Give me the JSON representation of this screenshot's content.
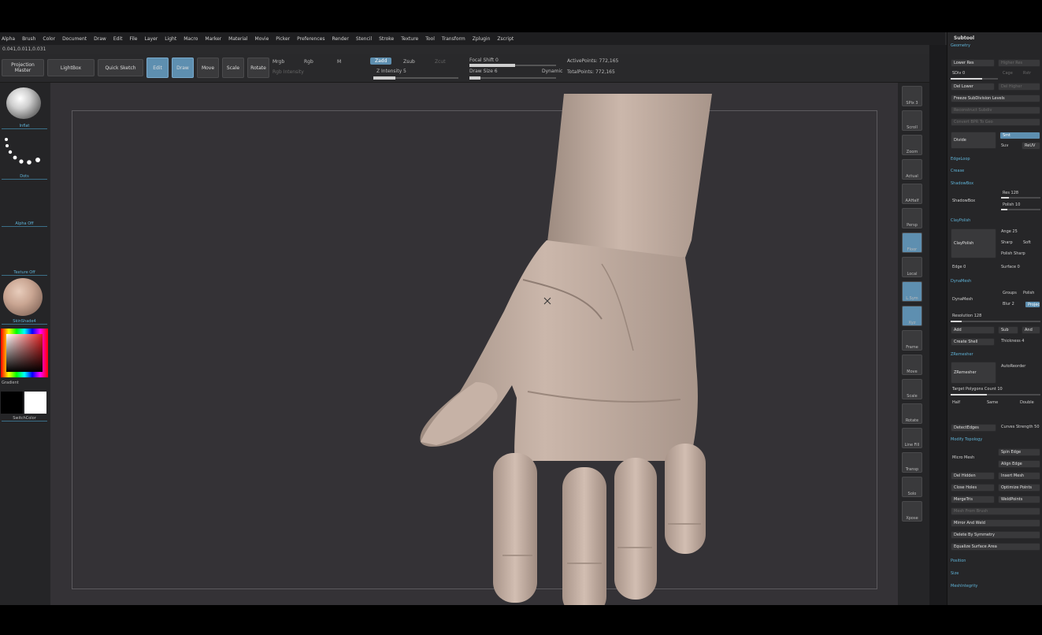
{
  "menu": [
    "Alpha",
    "Brush",
    "Color",
    "Document",
    "Draw",
    "Edit",
    "File",
    "Layer",
    "Light",
    "Macro",
    "Marker",
    "Material",
    "Movie",
    "Picker",
    "Preferences",
    "Render",
    "Stencil",
    "Stroke",
    "Texture",
    "Tool",
    "Transform",
    "Zplugin",
    "Zscript"
  ],
  "coords": "0.041,0.011,0.031",
  "toolbar": {
    "projection": "Projection Master",
    "lightbox": "LightBox",
    "quick_sketch": "Quick Sketch",
    "edit": "Edit",
    "draw": "Draw",
    "move": "Move",
    "scale": "Scale",
    "rotate": "Rotate",
    "mrgb": "Mrgb",
    "rgb": "Rgb",
    "m": "M",
    "rgb_intensity": "Rgb Intensity",
    "zadd": "Zadd",
    "zsub": "Zsub",
    "zcut": "Zcut",
    "z_intensity": "Z Intensity 5",
    "focal_shift": "Focal Shift 0",
    "draw_size": "Draw Size 6",
    "dynamic": "Dynamic",
    "active_points": "ActivePoints: 772,165",
    "total_points": "TotalPoints: 772,165"
  },
  "left_shelf": {
    "brush_label": "Inflat",
    "stroke_label": "Dots",
    "alpha_label": "Alpha Off",
    "texture_label": "Texture Off",
    "material_label": "SkinShade4",
    "gradient_label": "Gradient",
    "switch_label": "SwitchColor"
  },
  "right_shelf": [
    {
      "label": "SPix 3"
    },
    {
      "label": "Scroll"
    },
    {
      "label": "Zoom"
    },
    {
      "label": "Actual"
    },
    {
      "label": "AAHalf"
    },
    {
      "label": "Persp"
    },
    {
      "label": "Floor"
    },
    {
      "label": "Local"
    },
    {
      "label": "L.Sym"
    },
    {
      "label": "Xyz"
    },
    {
      "label": "Frame"
    },
    {
      "label": "Move"
    },
    {
      "label": "Scale"
    },
    {
      "label": "Rotate"
    },
    {
      "label": "Line Fill"
    },
    {
      "label": "Transp"
    },
    {
      "label": "Solo"
    },
    {
      "label": "Xpose"
    }
  ],
  "panel": {
    "title": "Subtool",
    "geometry": "Geometry",
    "lower_res": "Lower Res",
    "higher_res": "Higher Res",
    "sdiv": "SDiv 0",
    "cage": "Cage",
    "rstr": "Rstr",
    "del_lower": "Del Lower",
    "del_higher": "Del Higher",
    "freeze": "Freeze SubDivision Levels",
    "reconstruct": "Reconstruct Subdiv",
    "convert": "Convert BPR To Geo",
    "divide": "Divide",
    "smt": "Smt",
    "suv": "Suv",
    "reuv": "ReUV",
    "edgeloop": "EdgeLoop",
    "crease": "Crease",
    "shadowbox_sec": "ShadowBox",
    "shadowbox": "ShadowBox",
    "res": "Res 128",
    "polish": "Polish 10",
    "clay_sec": "ClayPolish",
    "claypolish": "ClayPolish",
    "angle": "Ange 25",
    "sharp": "Sharp",
    "soft": "Soft",
    "polish_sharp": "Polish Sharp",
    "edge": "Edge 0",
    "surface": "Surface 0",
    "dynamesh_sec": "DynaMesh",
    "dynamesh": "DynaMesh",
    "groups": "Groups",
    "polish2": "Polish",
    "blur": "Blur 2",
    "project": "Project",
    "resolution": "Resolution 128",
    "add": "Add",
    "sub": "Sub",
    "and": "And",
    "create_shell": "Create Shell",
    "thickness": "Thickness 4",
    "zremesher_sec": "ZRemesher",
    "zremesher": "ZRemesher",
    "freezeborder": "FreezeBorder",
    "freezegroups": "FreezeGroups",
    "smoothgroups": "SmoothGroups",
    "keepgroups": "KeepGroups",
    "detect_edges": "DetectEdges",
    "autoreorder": "AutoReorder",
    "target": "Target Polygons Count 10",
    "half": "Half",
    "same": "Same",
    "double": "Double",
    "adapt": "Adapt",
    "adaptive": "AdaptiveSize 50",
    "curves": "Curves Strength 50",
    "use_polypaint": "Use Polypaint",
    "color_density": "ColorDensity",
    "modify_sec": "Modify Topology",
    "micro_mesh": "Micro Mesh",
    "spin_edge": "Spin Edge",
    "align_edge": "Align Edge",
    "del_hidden": "Del Hidden",
    "insert_mesh": "Insert Mesh",
    "close_holes": "Close Holes",
    "optimize": "Optimize Points",
    "mergetris": "MergeTris",
    "weldpoints": "WeldPoints",
    "mesh_from_brush": "Mesh From Brush",
    "mirror_weld": "Mirror And Weld",
    "delete_sym": "Delete By Symmetry",
    "equalize": "Equalize Surface Area",
    "position": "Position",
    "size": "Size",
    "meshintegrity": "MeshIntegrity"
  }
}
